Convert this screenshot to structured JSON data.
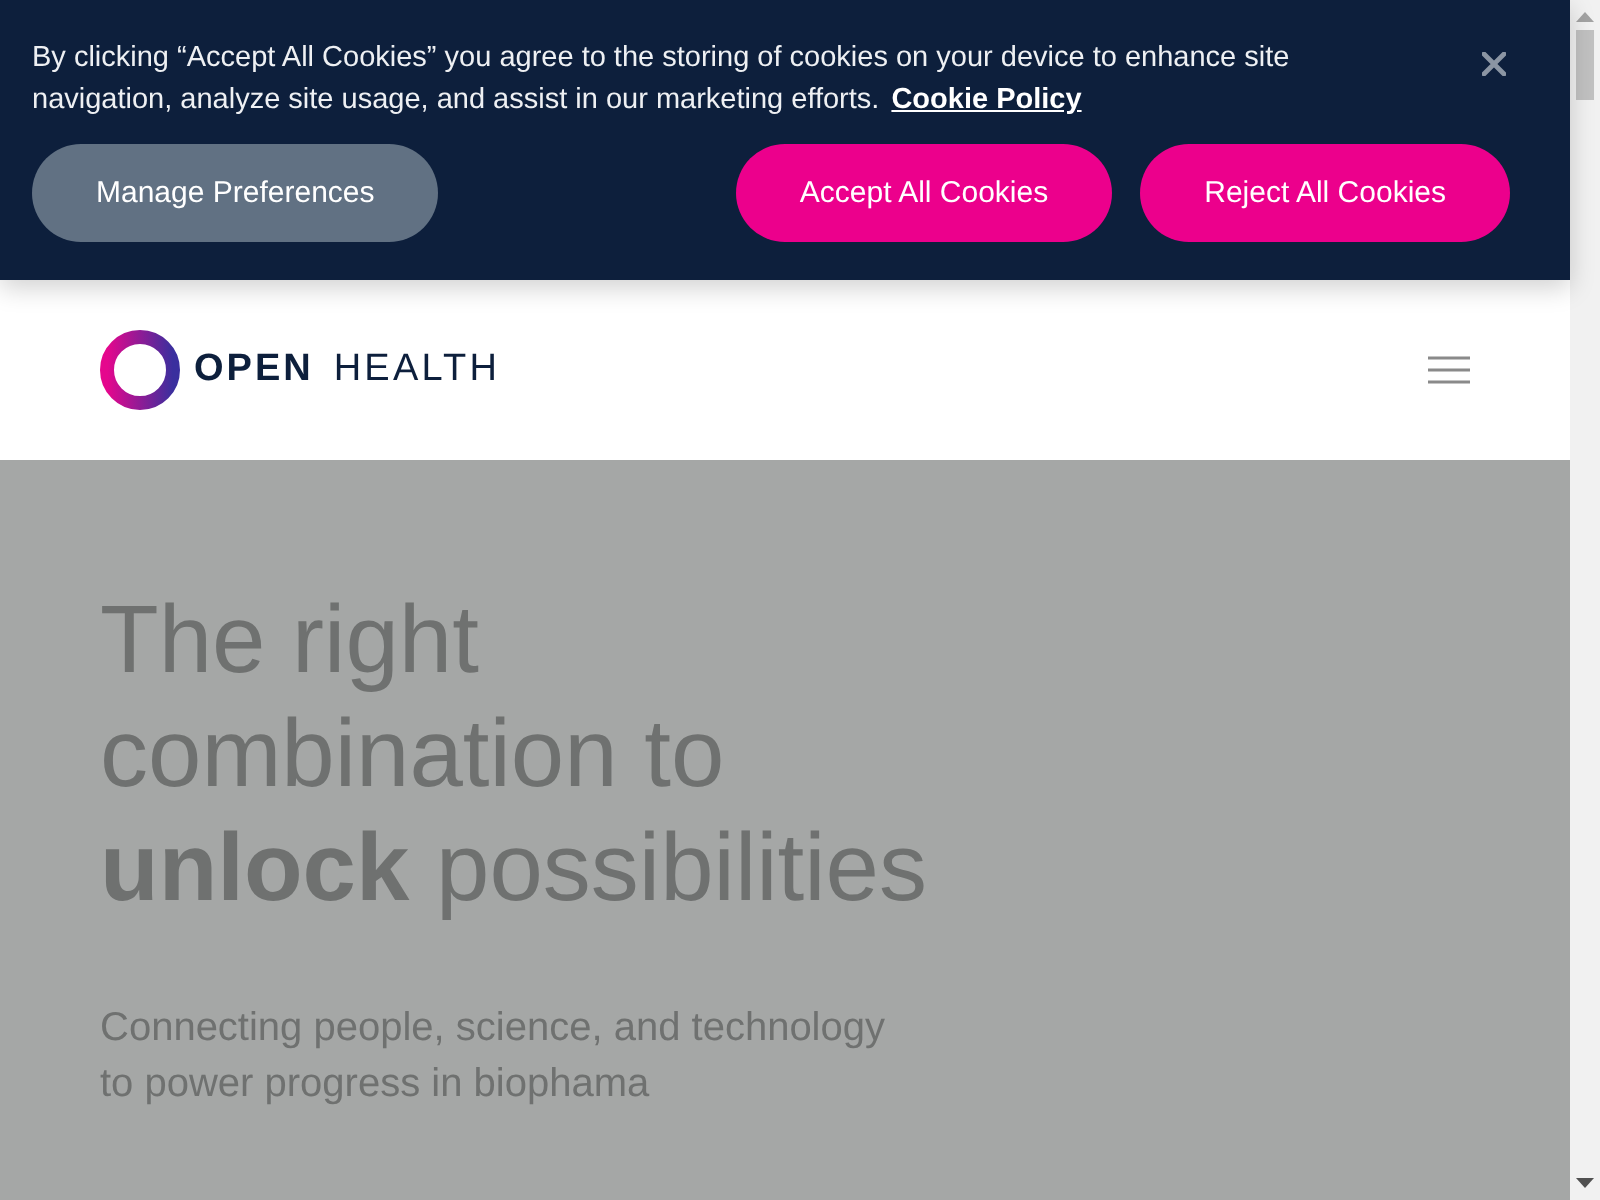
{
  "cookie_banner": {
    "message": "By clicking “Accept All Cookies” you agree to the storing of cookies on your device to enhance site navigation, analyze site usage, and assist in our marketing efforts.",
    "policy_link": "Cookie Policy",
    "buttons": [
      {
        "label": "Manage Preferences",
        "kind": "secondary"
      },
      {
        "label": "Accept All Cookies",
        "kind": "primary"
      },
      {
        "label": "Reject All Cookies",
        "kind": "primary"
      }
    ]
  },
  "header": {
    "logo": {
      "primary": "OPEN",
      "secondary": "HEALTH"
    }
  },
  "hero": {
    "headline": "The right combination to **unlock** possibilities",
    "subtitle": "Connecting people, science, and technology to power progress in biophama"
  }
}
